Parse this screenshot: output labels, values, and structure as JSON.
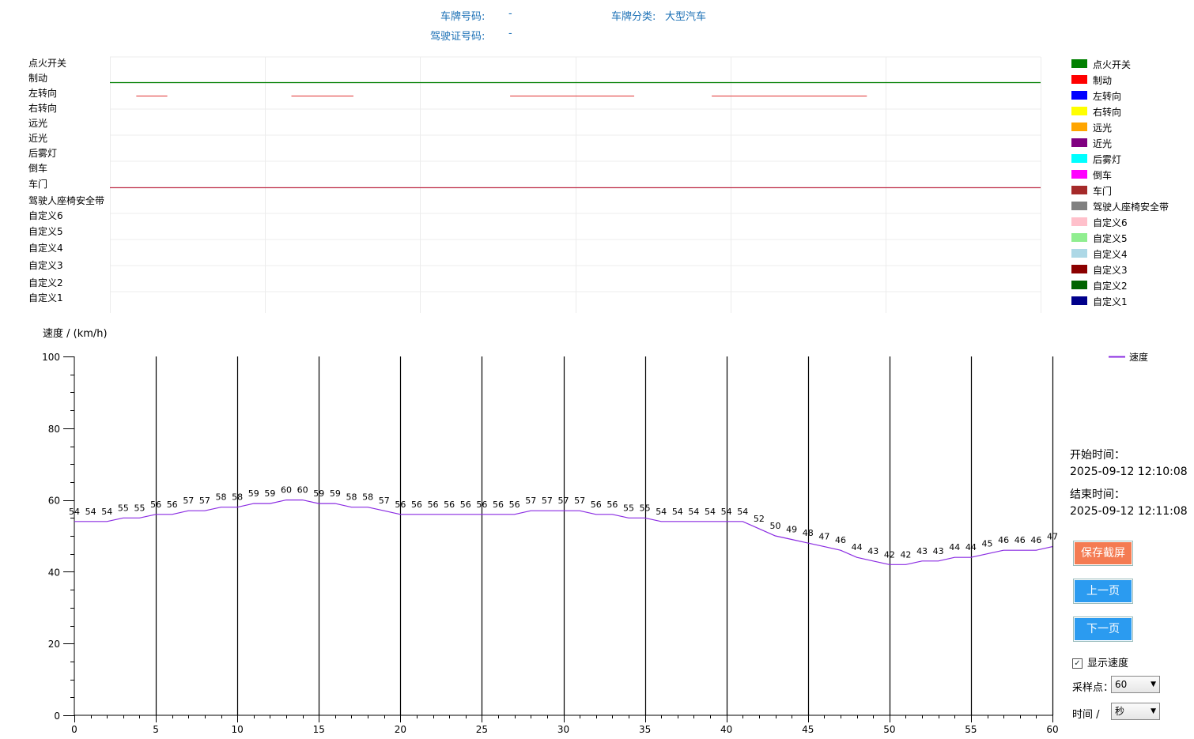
{
  "header": {
    "plate_label": "车牌号码:",
    "plate_value": "-",
    "category_label": "车牌分类:",
    "category_value": "大型汽车",
    "license_label": "驾驶证号码:",
    "license_value": "-"
  },
  "signals": [
    {
      "name": "点火开关",
      "color": "#008000"
    },
    {
      "name": "制动",
      "color": "#ff0000"
    },
    {
      "name": "左转向",
      "color": "#0000ff"
    },
    {
      "name": "右转向",
      "color": "#ffff00"
    },
    {
      "name": "远光",
      "color": "#ffa500"
    },
    {
      "name": "近光",
      "color": "#800080"
    },
    {
      "name": "后雾灯",
      "color": "#00ffff"
    },
    {
      "name": "倒车",
      "color": "#ff00ff"
    },
    {
      "name": "车门",
      "color": "#a52a2a"
    },
    {
      "name": "驾驶人座椅安全带",
      "color": "#808080"
    },
    {
      "name": "自定义6",
      "color": "#ffc0cb"
    },
    {
      "name": "自定义5",
      "color": "#90ee90"
    },
    {
      "name": "自定义4",
      "color": "#add8e6"
    },
    {
      "name": "自定义3",
      "color": "#8b0000"
    },
    {
      "name": "自定义2",
      "color": "#006400"
    },
    {
      "name": "自定义1",
      "color": "#00008b"
    }
  ],
  "signal_chart": {
    "x_range": [
      0,
      60
    ],
    "ignition_on": [
      0,
      60
    ],
    "brake_segments": [
      [
        1.7,
        3.7
      ],
      [
        11.7,
        15.7
      ],
      [
        25.8,
        33.8
      ],
      [
        38.8,
        48.8
      ]
    ],
    "door_on": [
      0,
      60
    ]
  },
  "chart_data": {
    "type": "line",
    "ylabel": "速度 / (km/h)",
    "xlim": [
      0,
      60
    ],
    "ylim": [
      0,
      100
    ],
    "x_ticks": [
      0,
      5,
      10,
      15,
      20,
      25,
      30,
      35,
      40,
      45,
      50,
      55,
      60
    ],
    "y_ticks": [
      0,
      20,
      40,
      60,
      80,
      100
    ],
    "legend_position": "top-right",
    "series": [
      {
        "name": "速度",
        "color": "#8a2be2",
        "x": [
          0,
          1,
          2,
          3,
          4,
          5,
          6,
          7,
          8,
          9,
          10,
          11,
          12,
          13,
          14,
          15,
          16,
          17,
          18,
          19,
          20,
          21,
          22,
          23,
          24,
          25,
          26,
          27,
          28,
          29,
          30,
          31,
          32,
          33,
          34,
          35,
          36,
          37,
          38,
          39,
          40,
          41,
          42,
          43,
          44,
          45,
          46,
          47,
          48,
          49,
          50,
          51,
          52,
          53,
          54,
          55,
          56,
          57,
          58,
          59,
          60
        ],
        "values": [
          54,
          54,
          54,
          55,
          55,
          56,
          56,
          57,
          57,
          58,
          58,
          59,
          59,
          60,
          60,
          59,
          59,
          58,
          58,
          57,
          56,
          56,
          56,
          56,
          56,
          56,
          56,
          56,
          57,
          57,
          57,
          57,
          56,
          56,
          55,
          55,
          54,
          54,
          54,
          54,
          54,
          54,
          52,
          50,
          49,
          48,
          47,
          46,
          44,
          43,
          42,
          42,
          43,
          43,
          44,
          44,
          45,
          46,
          46,
          46,
          47
        ]
      }
    ]
  },
  "side": {
    "start_label": "开始时间：",
    "start_value": "2025-09-12 12:10:08",
    "end_label": "结束时间：",
    "end_value": "2025-09-12 12:11:08",
    "save_button": "保存截屏",
    "prev_button": "上一页",
    "next_button": "下一页",
    "show_speed_label": "显示速度",
    "show_speed_checked": true,
    "sample_label": "采样点：",
    "sample_value": "60",
    "time_label": "时间 /",
    "time_value": "秒"
  }
}
